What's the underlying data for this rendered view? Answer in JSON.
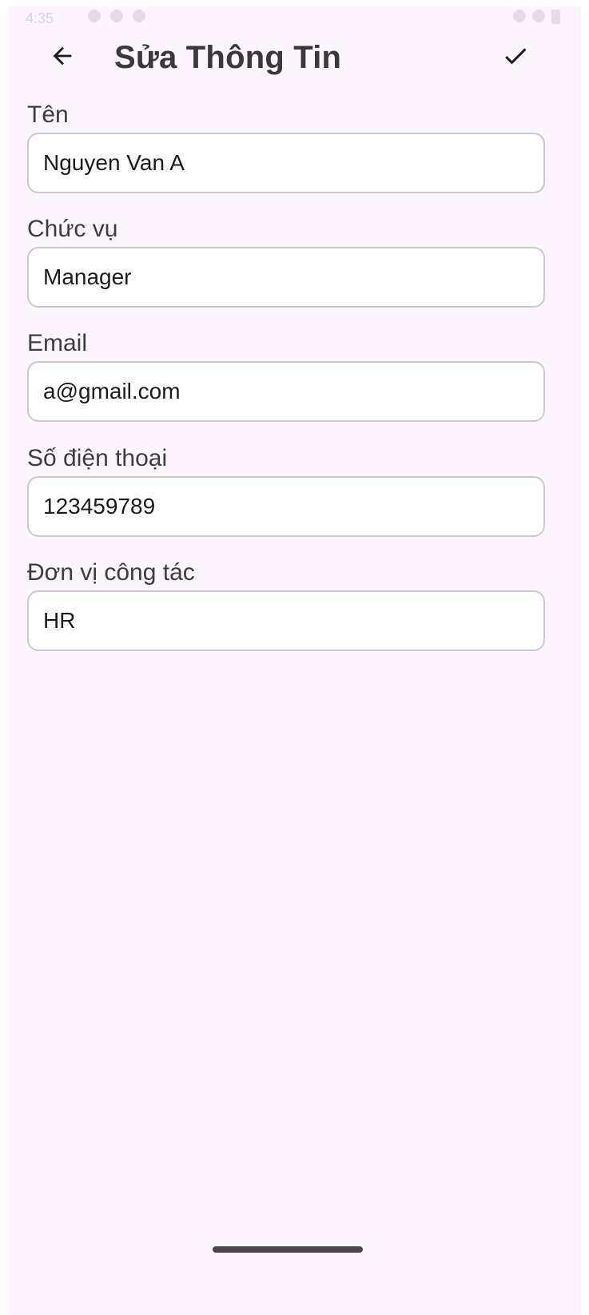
{
  "status_bar": {
    "time": "4:35"
  },
  "app_bar": {
    "title": "Sửa Thông Tin"
  },
  "fields": [
    {
      "label": "Tên",
      "value": "Nguyen Van A"
    },
    {
      "label": "Chức vụ",
      "value": "Manager"
    },
    {
      "label": "Email",
      "value": "a@gmail.com"
    },
    {
      "label": "Số điện thoại",
      "value": "123459789"
    },
    {
      "label": "Đơn vị công tác",
      "value": "HR"
    }
  ],
  "icons": {
    "back": "arrow-back-icon",
    "save": "check-icon"
  },
  "colors": {
    "background": "#fcf5fd",
    "title": "#3b383c",
    "field_border": "#cdc8cf",
    "field_fill": "#ffffff"
  }
}
